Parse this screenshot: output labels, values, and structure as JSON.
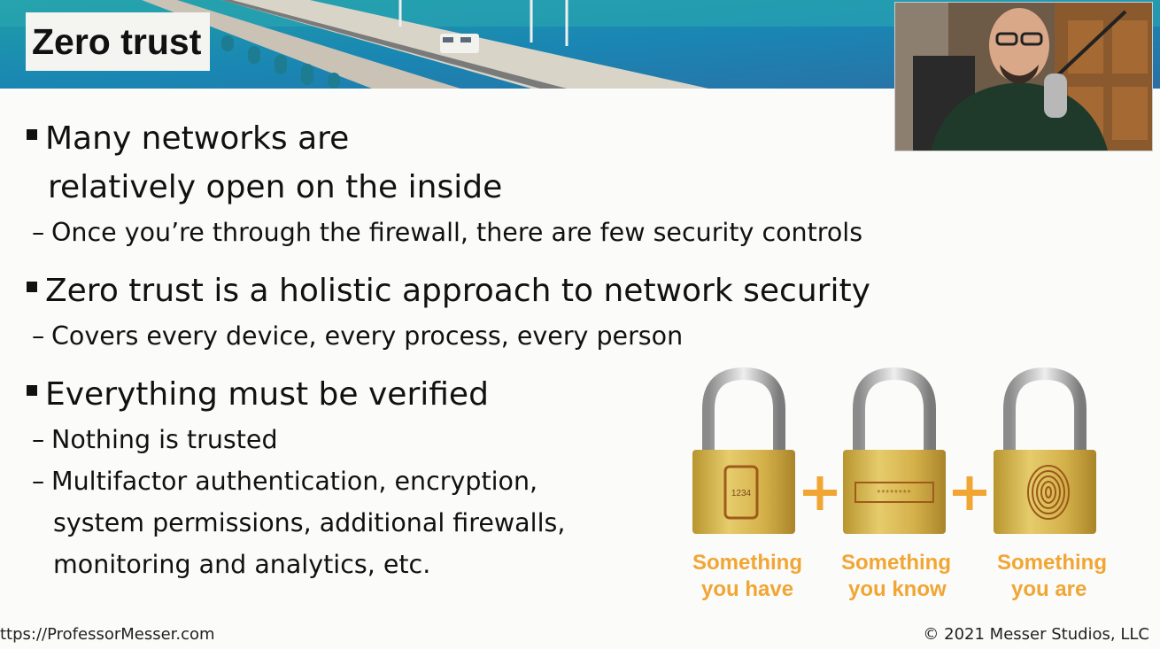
{
  "slide": {
    "title": "Zero trust",
    "bullets": [
      {
        "text_line1": "Many networks are",
        "text_line2": "relatively open on the inside",
        "subs": [
          "Once you’re through the firewall, there are few security controls"
        ]
      },
      {
        "text_line1": "Zero trust is a holistic approach to network security",
        "subs": [
          "Covers every device, every process, every person"
        ]
      },
      {
        "text_line1": "Everything must be verified",
        "subs": [
          "Nothing is trusted",
          "Multifactor authentication, encryption,",
          "system permissions, additional firewalls,",
          "monitoring and analytics, etc."
        ]
      }
    ],
    "locks": [
      {
        "line1": "Something",
        "line2": "you have",
        "display": "1234"
      },
      {
        "line1": "Something",
        "line2": "you know",
        "display": "********"
      },
      {
        "line1": "Something",
        "line2": "you are"
      }
    ]
  },
  "footer": {
    "left": "ttps://ProfessorMesser.com",
    "right": "© 2021 Messer Studios, LLC"
  },
  "colors": {
    "accent_orange": "#f1a634",
    "lock_gold": "#d8b74a"
  }
}
